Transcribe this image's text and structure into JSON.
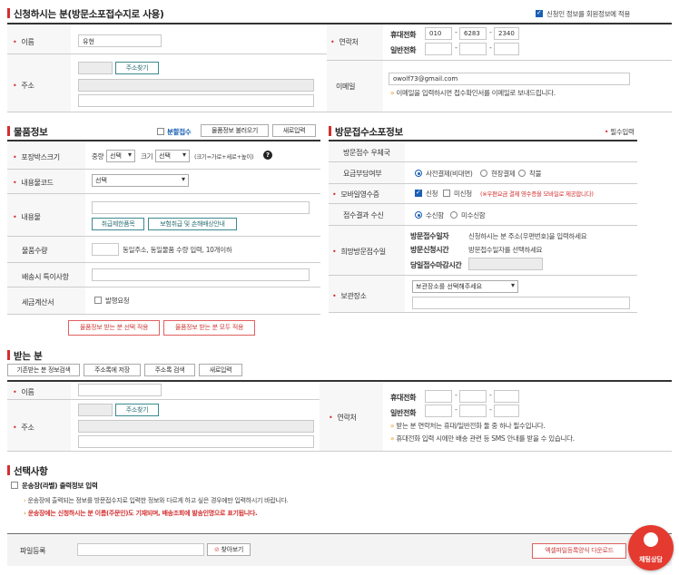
{
  "sender": {
    "title": "신청하시는 분(방문소포접수지로 사용)",
    "save_member_label": "신청인 정보를 회원정보에 적용",
    "name_label": "이름",
    "name_value": "유현",
    "contact_label": "연락처",
    "mobile_label": "휴대전화",
    "phone_label": "일반전화",
    "mobile": [
      "010",
      "6283",
      "2340"
    ],
    "address_label": "주소",
    "addr_search": "주소찾기",
    "email_label": "이메일",
    "email_value": "owolf73@gmail.com",
    "email_note": "이메일을 입력하시면 접수확인서를 이메일로 보내드립니다."
  },
  "goods": {
    "title": "물품정보",
    "split_label": "분할접수",
    "load_btn": "물품정보 불러오기",
    "new_btn": "새로입력",
    "box_label": "포장박스크기",
    "weight_label": "중량",
    "weight_sel": "선택",
    "size_label": "크기",
    "size_sel": "선택",
    "size_hint": "(크기=가로+세로+높이)",
    "code_label": "내용물코드",
    "code_sel": "선택",
    "content_label": "내용물",
    "forbid_btn": "취급제한품목",
    "insure_btn": "보험취급 및 손해배상안내",
    "qty_label": "물품수량",
    "qty_hint": "동일주소, 동일물품 수량 입력, 10개이하",
    "memo_label": "배송시 특이사항",
    "tax_label": "세금계산서",
    "tax_check": "발행요청",
    "apply_sel_btn": "물품정보 받는 분 선택 적용",
    "apply_all_btn": "물품정보 받는 분 모두 적용"
  },
  "visit": {
    "title": "방문접수소포정보",
    "required_note": "필수입력",
    "office_label": "방문접수 우체국",
    "fee_label": "요금부담여부",
    "fee_opts": [
      "사전결제(비대면)",
      "현장결제",
      "착불"
    ],
    "receipt_label": "모바일영수증",
    "receipt_opt1": "신청",
    "receipt_opt2": "미신청",
    "receipt_note": "(※우편요금 결제 영수증을 모바일로 제공합니다)",
    "result_label": "접수결과 수신",
    "result_opts": [
      "수신함",
      "미수신함"
    ],
    "date_label": "희망방문접수일",
    "visit_addr_label": "방문접수일자",
    "visit_addr_val": "신청하시는 분 주소(우편번호)을 입력하세요",
    "visit_time_label": "방문신청시간",
    "visit_time_val": "방문접수일자를 선택하세요",
    "deadline_label": "당일접수마감시간",
    "storage_label": "보관장소",
    "storage_sel": "보관장소를 선택해주세요"
  },
  "receiver": {
    "title": "받는 분",
    "tabs": [
      "기존받는 분 정보검색",
      "주소록에 저장",
      "주소록 검색",
      "새로입력"
    ],
    "name_label": "이름",
    "contact_label": "연락처",
    "mobile_label": "휴대전화",
    "phone_label": "일반전화",
    "address_label": "주소",
    "addr_search": "주소찾기",
    "note1": "받는 분 연락처는 휴대/일반전화 둘 중 하나 필수입니다.",
    "note2": "휴대전화 입력 시에만 배송 관련 등 SMS 안내를 받을 수 있습니다."
  },
  "options": {
    "title": "선택사항",
    "label_check": "운송장(라벨) 출력정보 입력",
    "note1": "운송장에 출력되는 정보를 방문접수지로 입력한 정보와 다르게 하고 싶은 경우에만 입력하시기 바랍니다.",
    "note2": "운송장에는 신청하시는 분 이름(주문인)도 기재되며, 배송조회에 발송인명으로 표기됩니다."
  },
  "file": {
    "label": "파일등록",
    "browse": "찾아보기",
    "download": "엑셀파일등록양식 다운로드"
  },
  "chat": {
    "label": "채팅상담"
  },
  "colors": {
    "accent": "#d32f2f",
    "blue": "#1a5fb4",
    "teal": "#2d6f74"
  }
}
